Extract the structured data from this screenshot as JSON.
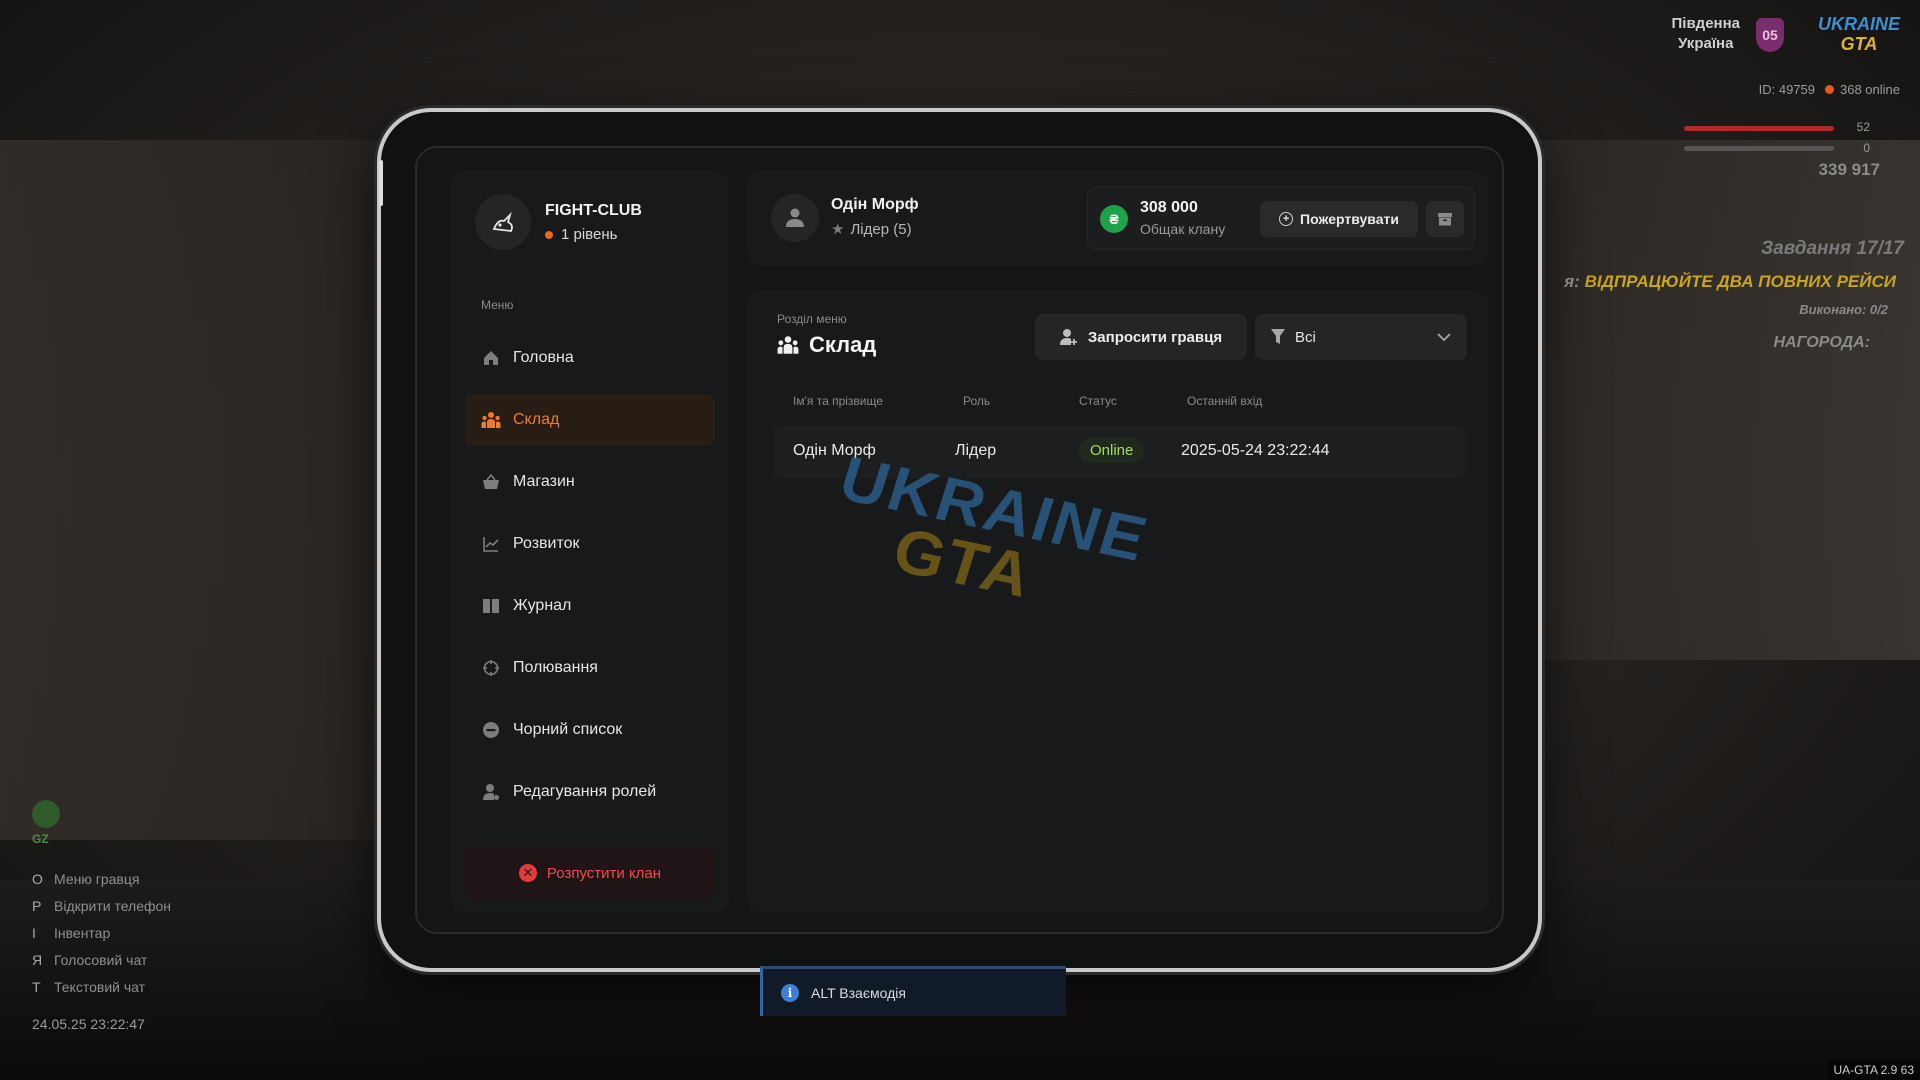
{
  "hud": {
    "region_line1": "Південна",
    "region_line2": "Україна",
    "server_badge": "05",
    "logo_top": "UKRAINE",
    "logo_bottom": "GTA",
    "player_id": "ID: 49759",
    "online": "368 online",
    "health": "52",
    "armor": "0",
    "money": "339 917",
    "quest_title": "Завдання 17/17",
    "quest_prefix": "я:",
    "quest_task": "ВІДПРАЦЮЙТЕ ДВА ПОВНИХ РЕЙСИ",
    "quest_done": "Виконано: 0/2",
    "quest_reward": "НАГОРОДА:",
    "gps_label": "GZ",
    "clock": "24.05.25 23:22:47",
    "version": "UA-GTA 2.9",
    "fps": "63",
    "hints": [
      {
        "key": "O",
        "label": "Меню гравця"
      },
      {
        "key": "P",
        "label": "Відкрити телефон"
      },
      {
        "key": "I",
        "label": "Інвентар"
      },
      {
        "key": "Я",
        "label": "Голосовий чат"
      },
      {
        "key": "T",
        "label": "Текстовий чат"
      }
    ]
  },
  "clan": {
    "name": "FIGHT-CLUB",
    "level": "1 рівень"
  },
  "menu": {
    "title": "Меню",
    "items": [
      {
        "label": "Головна",
        "icon": "home-icon"
      },
      {
        "label": "Склад",
        "icon": "members-icon"
      },
      {
        "label": "Магазин",
        "icon": "basket-icon"
      },
      {
        "label": "Розвиток",
        "icon": "chart-icon"
      },
      {
        "label": "Журнал",
        "icon": "book-icon"
      },
      {
        "label": "Полювання",
        "icon": "crosshair-icon"
      },
      {
        "label": "Чорний список",
        "icon": "minus-circle-icon"
      },
      {
        "label": "Редагування ролей",
        "icon": "user-gear-icon"
      }
    ],
    "active": "Склад",
    "disband": "Розпустити клан"
  },
  "user": {
    "name": "Одін Морф",
    "role": "Лідер (5)"
  },
  "bank": {
    "currency_symbol": "₴",
    "amount": "308 000",
    "label": "Общак клану",
    "donate": "Пожертвувати"
  },
  "section": {
    "subtitle": "Розділ меню",
    "title": "Склад",
    "invite": "Запросити гравця",
    "filter": "Всі"
  },
  "table": {
    "columns": [
      "Ім'я та прізвище",
      "Роль",
      "Статус",
      "Останній вхід"
    ],
    "rows": [
      {
        "name": "Одін Морф",
        "role": "Лідер",
        "status": "Online",
        "last_login": "2025-05-24 23:22:44"
      }
    ]
  },
  "watermark": {
    "top": "UKRAINE",
    "bottom": "GTA"
  },
  "interact": {
    "label": "ALT Взаємодія"
  },
  "colors": {
    "accent": "#ef7a2a",
    "online": "#9fe05a",
    "danger": "#ef4b4b",
    "coin": "#1fa34a"
  }
}
